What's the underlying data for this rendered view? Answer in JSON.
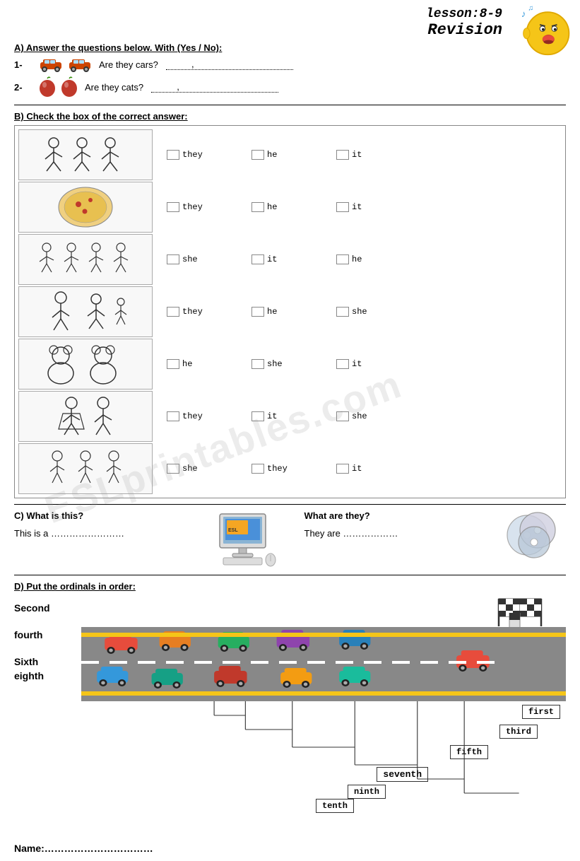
{
  "header": {
    "lesson": "lesson:8-9",
    "revision": "Revision"
  },
  "section_a": {
    "title": "A)  Answer the questions below. With (Yes / No):",
    "questions": [
      {
        "num": "1-",
        "text": "Are they cars?",
        "dots": "………… , ………… …………… ."
      },
      {
        "num": "2-",
        "text": "Are they cats?",
        "dots": "………… , ………… ……………. ."
      }
    ]
  },
  "section_b": {
    "title": "B) Check the box of the correct answer:",
    "rows": [
      {
        "choices": [
          [
            "they",
            "he",
            "it"
          ]
        ]
      },
      {
        "choices": [
          [
            "they",
            "he",
            "it"
          ]
        ]
      },
      {
        "choices": [
          [
            "she",
            "it",
            "he"
          ]
        ]
      },
      {
        "choices": [
          [
            "they",
            "he",
            "she"
          ]
        ]
      },
      {
        "choices": [
          [
            "he",
            "she",
            "it"
          ]
        ]
      },
      {
        "choices": [
          [
            "they",
            "it",
            "she"
          ]
        ]
      },
      {
        "choices": [
          [
            "she",
            "they",
            "it"
          ]
        ]
      }
    ]
  },
  "section_c": {
    "title_left": "C) What is this?",
    "title_right": "What are they?",
    "answer_left": "This is a ……………………",
    "answer_right": "They are ………………"
  },
  "section_d": {
    "title": "D) Put the ordinals in order:",
    "left_words": [
      "Second",
      "fourth",
      "Sixth",
      "eighth"
    ],
    "stair_words": [
      "first",
      "third",
      "fifth",
      "seventh",
      "ninth",
      "tenth"
    ]
  },
  "footer": {
    "name_label": "Name:……………………………"
  },
  "watermark": "ESLprintables.com"
}
